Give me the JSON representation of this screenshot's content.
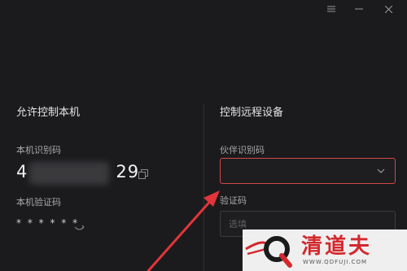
{
  "window": {
    "menu_icon": "menu-icon",
    "minimize_icon": "minimize-icon",
    "close_icon": "close-icon"
  },
  "left": {
    "title": "允许控制本机",
    "id_label": "本机识别码",
    "id_prefix": "4",
    "id_suffix": "29",
    "code_label": "本机验证码",
    "code_masked": "* * * * * *"
  },
  "right": {
    "title": "控制远程设备",
    "partner_label": "伙伴识别码",
    "partner_value": "",
    "code_label": "验证码",
    "code_placeholder": "选填"
  },
  "watermark": {
    "title": "清道夫",
    "url": "WWW.QDFUJI.COM"
  },
  "colors": {
    "background": "#1b1b1d",
    "focus_border": "#d14848",
    "arrow": "#e2353a",
    "watermark": "#d3282d"
  }
}
